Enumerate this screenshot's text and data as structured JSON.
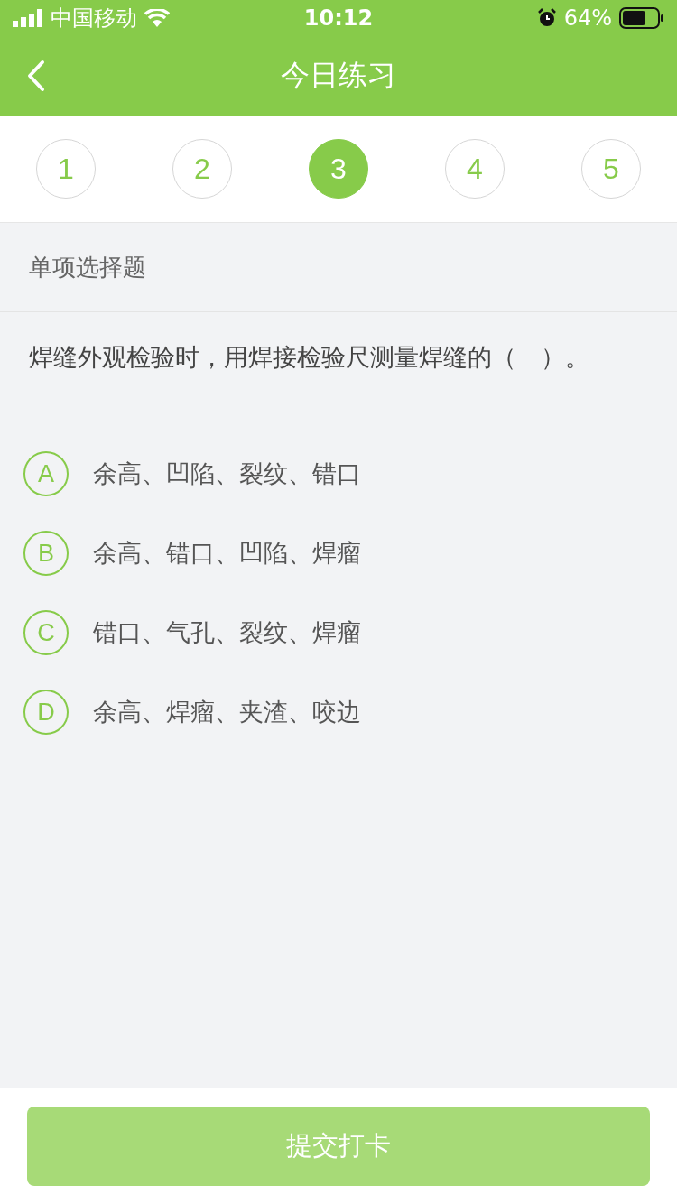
{
  "status_bar": {
    "carrier": "中国移动",
    "time": "10:12",
    "battery": "64%"
  },
  "nav": {
    "title": "今日练习"
  },
  "question_numbers": [
    {
      "label": "1",
      "selected": false
    },
    {
      "label": "2",
      "selected": false
    },
    {
      "label": "3",
      "selected": true
    },
    {
      "label": "4",
      "selected": false
    },
    {
      "label": "5",
      "selected": false
    }
  ],
  "question": {
    "type": "单项选择题",
    "text": "焊缝外观检验时，用焊接检验尺测量焊缝的（　）。"
  },
  "options": [
    {
      "letter": "A",
      "text": "余高、凹陷、裂纹、错口"
    },
    {
      "letter": "B",
      "text": "余高、错口、凹陷、焊瘤"
    },
    {
      "letter": "C",
      "text": "错口、气孔、裂纹、焊瘤"
    },
    {
      "letter": "D",
      "text": "余高、焊瘤、夹渣、咬边"
    }
  ],
  "submit_button": {
    "label": "提交打卡",
    "disabled": true
  }
}
